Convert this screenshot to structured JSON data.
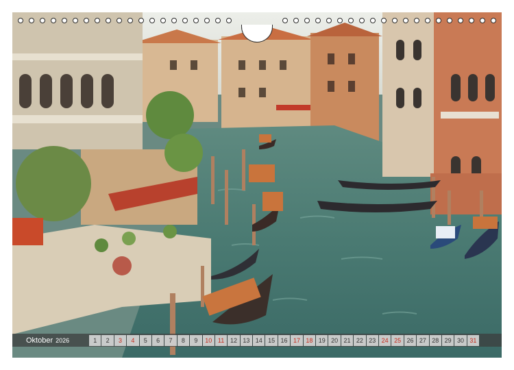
{
  "calendar": {
    "month": "Oktober",
    "year": "2026",
    "days": [
      {
        "n": "1",
        "red": false
      },
      {
        "n": "2",
        "red": false
      },
      {
        "n": "3",
        "red": true
      },
      {
        "n": "4",
        "red": true
      },
      {
        "n": "5",
        "red": false
      },
      {
        "n": "6",
        "red": false
      },
      {
        "n": "7",
        "red": false
      },
      {
        "n": "8",
        "red": false
      },
      {
        "n": "9",
        "red": false
      },
      {
        "n": "10",
        "red": true
      },
      {
        "n": "11",
        "red": true
      },
      {
        "n": "12",
        "red": false
      },
      {
        "n": "13",
        "red": false
      },
      {
        "n": "14",
        "red": false
      },
      {
        "n": "15",
        "red": false
      },
      {
        "n": "16",
        "red": false
      },
      {
        "n": "17",
        "red": true
      },
      {
        "n": "18",
        "red": true
      },
      {
        "n": "19",
        "red": false
      },
      {
        "n": "20",
        "red": false
      },
      {
        "n": "21",
        "red": false
      },
      {
        "n": "22",
        "red": false
      },
      {
        "n": "23",
        "red": false
      },
      {
        "n": "24",
        "red": true
      },
      {
        "n": "25",
        "red": true
      },
      {
        "n": "26",
        "red": false
      },
      {
        "n": "27",
        "red": false
      },
      {
        "n": "28",
        "red": false
      },
      {
        "n": "29",
        "red": false
      },
      {
        "n": "30",
        "red": false
      },
      {
        "n": "31",
        "red": true
      }
    ]
  },
  "colors": {
    "weekend": "#c62a1a",
    "water": "#4f7d76",
    "sky": "#e9ebe6"
  },
  "photo": {
    "subject": "miniature Venetian canal with gondolas"
  }
}
